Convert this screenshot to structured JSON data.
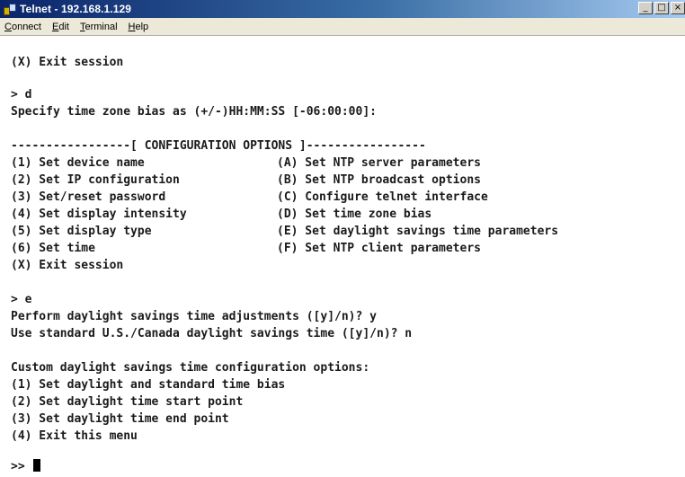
{
  "window": {
    "title": "Telnet - 192.168.1.129",
    "buttons": {
      "minimize": "_",
      "maximize": "□",
      "close": "×"
    }
  },
  "menu": {
    "connect": {
      "ul": "C",
      "rest": "onnect"
    },
    "edit": {
      "ul": "E",
      "rest": "dit"
    },
    "terminal": {
      "ul": "T",
      "rest": "erminal"
    },
    "help": {
      "ul": "H",
      "rest": "elp"
    }
  },
  "terminal": {
    "exit_session_top": "(X) Exit session",
    "prompt_d": "> d",
    "tz_prompt": "Specify time zone bias as (+/-)HH:MM:SS [-06:00:00]:",
    "config_header": "-----------------[ CONFIGURATION OPTIONS ]-----------------",
    "options_left": [
      "(1) Set device name",
      "(2) Set IP configuration",
      "(3) Set/reset password",
      "(4) Set display intensity",
      "(5) Set display type",
      "(6) Set time",
      "(X) Exit session"
    ],
    "options_right": [
      "(A) Set NTP server parameters",
      "(B) Set NTP broadcast options",
      "(C) Configure telnet interface",
      "(D) Set time zone bias",
      "(E) Set daylight savings time parameters",
      "(F) Set NTP client parameters"
    ],
    "prompt_e": "> e",
    "dst_question": "Perform daylight savings time adjustments ([y]/n)? y",
    "us_canada_question": "Use standard U.S./Canada daylight savings time ([y]/n)? n",
    "custom_header": "Custom daylight savings time configuration options:",
    "custom_options": [
      "(1) Set daylight and standard time bias",
      "(2) Set daylight time start point",
      "(3) Set daylight time end point",
      "(4) Exit this menu"
    ],
    "final_prompt": ">> "
  }
}
